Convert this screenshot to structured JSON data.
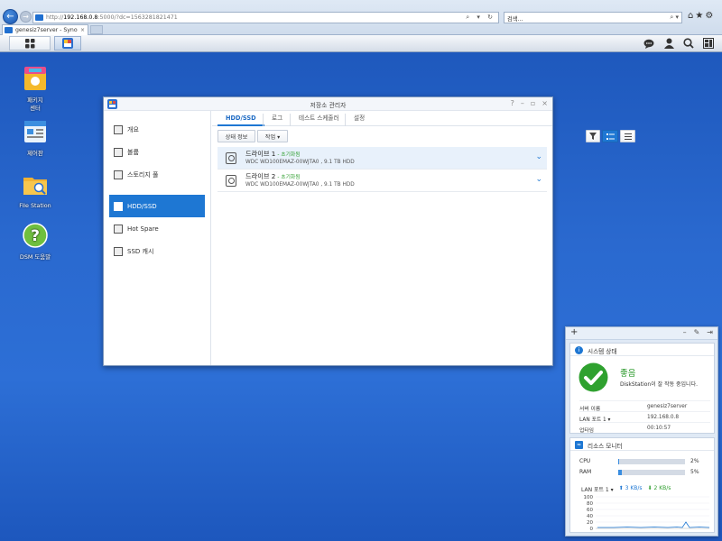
{
  "browser": {
    "url_prefix": "http://",
    "url_host": "192.168.0.8",
    "url_rest": ":5000/?dc=1563281821471",
    "search_placeholder": "검색...",
    "tab_title": "genesiz7server - Synology ...",
    "tab_close": "×"
  },
  "desktop_icons": [
    {
      "label": "패키지\n센터",
      "icon": "package-center-icon"
    },
    {
      "label": "제어판",
      "icon": "control-panel-icon"
    },
    {
      "label": "File Station",
      "icon": "file-station-icon"
    },
    {
      "label": "DSM 도움말",
      "icon": "help-icon"
    }
  ],
  "window": {
    "title": "저장소 관리자",
    "sidebar": [
      {
        "label": "개요",
        "icon": "overview-icon"
      },
      {
        "label": "볼륨",
        "icon": "volume-icon"
      },
      {
        "label": "스토리지 풀",
        "icon": "storage-pool-icon"
      },
      {
        "label": "HDD/SSD",
        "icon": "hdd-ssd-icon",
        "active": true
      },
      {
        "label": "Hot Spare",
        "icon": "hot-spare-icon"
      },
      {
        "label": "SSD 캐시",
        "icon": "ssd-cache-icon"
      }
    ],
    "tabs": [
      "HDD/SSD",
      "로그",
      "테스트 스케줄러",
      "설정"
    ],
    "buttons": {
      "status_info": "상태 정보",
      "operation": "작업 ▾"
    },
    "drives": [
      {
        "name": "드라이브 1",
        "status": "- 초기화됨",
        "detail": "WDC WD100EMAZ-00WJTA0 , 9.1 TB HDD"
      },
      {
        "name": "드라이브 2",
        "status": "- 초기화됨",
        "detail": "WDC WD100EMAZ-00WJTA0 , 9.1 TB HDD"
      }
    ]
  },
  "widgets": {
    "system_health": {
      "title": "시스템 상태",
      "status": "좋음",
      "message": "DiskStation이 잘 작동 중입니다.",
      "rows": [
        {
          "label": "서버 이름",
          "value": "genesiz7server"
        },
        {
          "label": "LAN 포트 1 ▾",
          "value": "192.168.0.8"
        },
        {
          "label": "업타임",
          "value": "00:10:57"
        }
      ]
    },
    "resource_monitor": {
      "title": "리소스 모니터",
      "cpu_label": "CPU",
      "cpu_pct": "2%",
      "cpu_value": 2,
      "ram_label": "RAM",
      "ram_pct": "5%",
      "ram_value": 5,
      "lan_label": "LAN 포트 1 ▾",
      "lan_up": "⬆ 3 KB/s",
      "lan_down": "⬇ 2 KB/s",
      "chart_ticks": [
        "100",
        "80",
        "60",
        "40",
        "20",
        "0"
      ]
    }
  },
  "colors": {
    "accent": "#1e77d3",
    "ok_green": "#2c9a2c"
  }
}
